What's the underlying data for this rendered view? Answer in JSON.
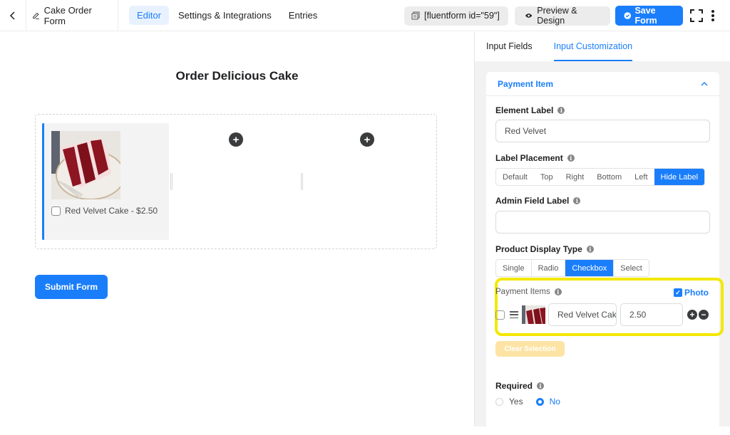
{
  "topbar": {
    "back_icon": "chevron-left-icon",
    "form_icon": "pencil-icon",
    "form_title": "Cake Order Form",
    "nav": [
      {
        "label": "Editor",
        "active": true
      },
      {
        "label": "Settings & Integrations",
        "active": false
      },
      {
        "label": "Entries",
        "active": false
      }
    ],
    "shortcode": "[fluentform id=\"59\"]",
    "preview_label": "Preview & Design",
    "save_label": "Save Form"
  },
  "canvas": {
    "title": "Order Delicious Cake",
    "product_label": "Red Velvet Cake - $2.50",
    "product_checked": false,
    "submit_label": "Submit Form"
  },
  "sidebar": {
    "tabs": [
      {
        "label": "Input Fields",
        "active": false
      },
      {
        "label": "Input Customization",
        "active": true
      }
    ],
    "panel_title": "Payment Item",
    "element_label": {
      "label": "Element Label",
      "value": "Red Velvet"
    },
    "label_placement": {
      "label": "Label Placement",
      "options": [
        "Default",
        "Top",
        "Right",
        "Bottom",
        "Left",
        "Hide Label"
      ],
      "selected": "Hide Label"
    },
    "admin_field_label": {
      "label": "Admin Field Label",
      "value": ""
    },
    "product_display_type": {
      "label": "Product Display Type",
      "options": [
        "Single",
        "Radio",
        "Checkbox",
        "Select"
      ],
      "selected": "Checkbox"
    },
    "payment_items": {
      "label": "Payment Items",
      "photo_label": "Photo",
      "photo_checked": true,
      "items": [
        {
          "name": "Red Velvet Cake",
          "price": "2.50",
          "checked": false
        }
      ]
    },
    "clear_selection_label": "Clear Selection",
    "required": {
      "label": "Required",
      "options": [
        "Yes",
        "No"
      ],
      "selected": "No"
    }
  },
  "colors": {
    "accent": "#1a7efb",
    "highlight": "#f3e800",
    "clear_button": "#fde4a5"
  }
}
